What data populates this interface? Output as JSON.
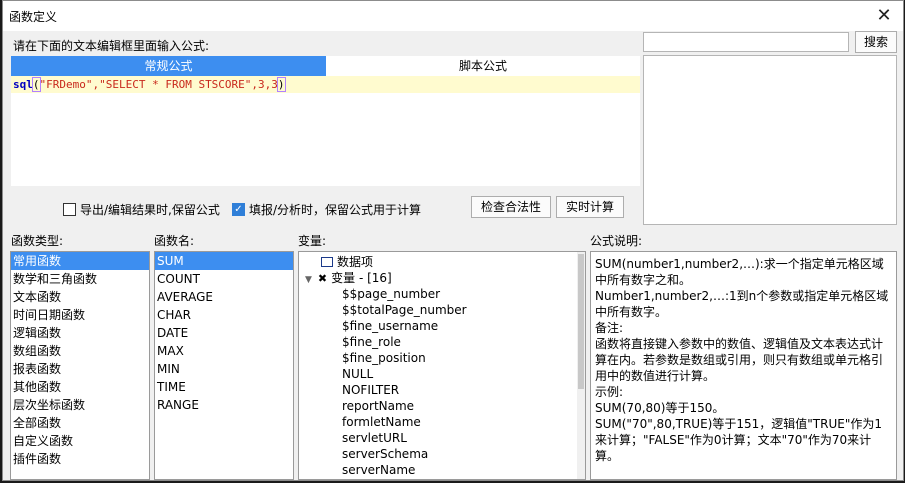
{
  "window": {
    "title": "函数定义"
  },
  "prompt": "请在下面的文本编辑框里面输入公式:",
  "tabs": {
    "normal": "常规公式",
    "script": "脚本公式"
  },
  "formula": {
    "fn": "sql",
    "open": "(",
    "args": "\"FRDemo\",\"SELECT * FROM STSCORE\",3,3",
    "close": ")"
  },
  "search": {
    "value": "",
    "button": "搜索"
  },
  "options": {
    "export_keep": {
      "label": "导出/编辑结果时,保留公式",
      "checked": false
    },
    "fill_keep": {
      "label": "填报/分析时，保留公式用于计算",
      "checked": true
    }
  },
  "buttons": {
    "check": "检查合法性",
    "realtime": "实时计算"
  },
  "labels": {
    "category": "函数类型:",
    "name": "函数名:",
    "variables": "变量:",
    "description": "公式说明:"
  },
  "categories": [
    "常用函数",
    "数学和三角函数",
    "文本函数",
    "时间日期函数",
    "逻辑函数",
    "数组函数",
    "报表函数",
    "其他函数",
    "层次坐标函数",
    "全部函数",
    "自定义函数",
    "插件函数"
  ],
  "functions": [
    "SUM",
    "COUNT",
    "AVERAGE",
    "CHAR",
    "DATE",
    "MAX",
    "MIN",
    "TIME",
    "RANGE"
  ],
  "variables": {
    "dataset_label": "数据项",
    "group_label": "变量 - [16]",
    "items": [
      "$$page_number",
      "$$totalPage_number",
      "$fine_username",
      "$fine_role",
      "$fine_position",
      "NULL",
      "NOFILTER",
      "reportName",
      "formletName",
      "servletURL",
      "serverSchema",
      "serverName"
    ]
  },
  "description": [
    "SUM(number1,number2,…):求一个指定单元格区域中所有数字之和。",
    "Number1,number2,…:1到n个参数或指定单元格区域中所有数字。",
    "备注:",
    "函数将直接键入参数中的数值、逻辑值及文本表达式计算在内。若参数是数组或引用，则只有数组或单元格引用中的数值进行计算。",
    "示例:",
    "SUM(70,80)等于150。",
    "SUM(\"70\",80,TRUE)等于151，逻辑值\"TRUE\"作为1来计算；\"FALSE\"作为0计算；文本\"70\"作为70来计算。"
  ],
  "colors": {
    "accent": "#3d8ef0",
    "editor_bg": "#fffbcf"
  }
}
